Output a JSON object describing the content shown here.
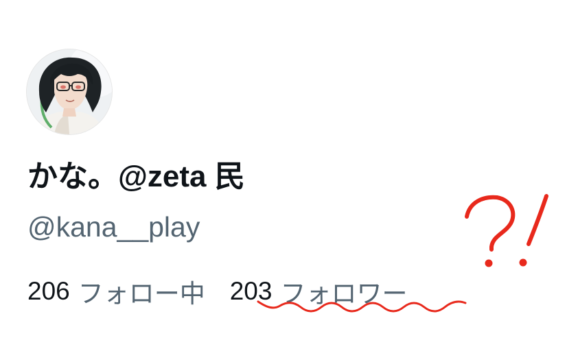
{
  "profile": {
    "avatar_icon": "avatar-image",
    "display_name": "かな。@zeta 民",
    "handle": "@kana__play"
  },
  "stats": {
    "following_count": "206",
    "following_label": "フォロー中",
    "followers_count": "203",
    "followers_label": "フォロワー"
  },
  "annotation": {
    "marks": "?!",
    "ink_color": "#e8291c"
  }
}
